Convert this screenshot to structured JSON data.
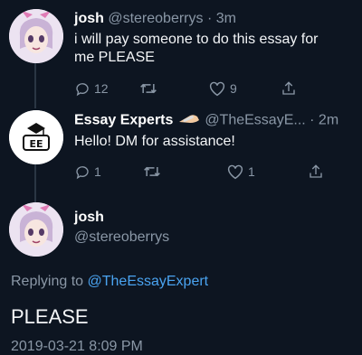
{
  "tweets": [
    {
      "name": "josh",
      "handle": "@stereoberrys",
      "time": "· 3m",
      "text_line1": "i will pay someone to do this essay for",
      "text_line2": "me PLEASE",
      "reply_count": "12",
      "retweet_count": "",
      "like_count": "9"
    },
    {
      "name": "Essay Experts",
      "handle": "@TheEssayE...",
      "time": "· 2m",
      "text": "Hello! DM for assistance!",
      "reply_count": "1",
      "retweet_count": "",
      "like_count": "1",
      "avatar_text": "EE"
    }
  ],
  "reply_tweet": {
    "name": "josh",
    "handle": "@stereoberrys",
    "replying_prefix": "Replying to",
    "replying_to": "@TheEssayExpert",
    "text": "PLEASE",
    "timestamp": "2019-03-21 8:09 PM"
  },
  "colors": {
    "background": "#0d1521",
    "muted": "#8a97a6",
    "link": "#4aa3f0"
  }
}
